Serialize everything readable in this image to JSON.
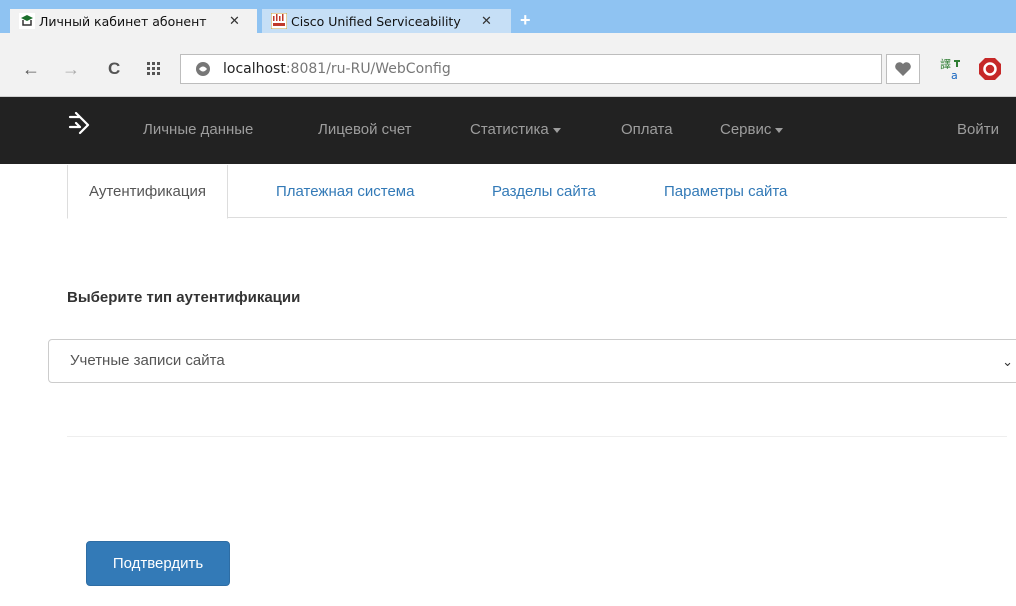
{
  "browser": {
    "tabs": [
      {
        "title": "Личный кабинет абонент",
        "close": "✕"
      },
      {
        "title": "Cisco Unified Serviceability",
        "close": "✕"
      }
    ],
    "new_tab": "+",
    "nav": {
      "back": "←",
      "forward": "→",
      "reload": "C"
    },
    "url_host": "localhost",
    "url_path": ":8081/ru-RU/WebConfig"
  },
  "navbar": {
    "items": [
      "Личные данные",
      "Лицевой счет",
      "Статистика",
      "Оплата",
      "Сервис"
    ],
    "login": "Войти"
  },
  "content_tabs": [
    "Аутентификация",
    "Платежная система",
    "Разделы сайта",
    "Параметры сайта"
  ],
  "form": {
    "label": "Выберите тип аутентификации",
    "selected": "Учетные записи сайта",
    "submit": "Подтвердить"
  },
  "colors": {
    "browser_accent": "#8fc3f2",
    "navbar_bg": "#222222",
    "link": "#337ab7",
    "primary_button": "#337ab7"
  },
  "icons": [
    "site-favicon",
    "cisco-favicon",
    "apps-grid-icon",
    "site-info-icon",
    "heart-icon",
    "translate-icon",
    "stop-icon",
    "brand-logo-icon",
    "chevron-down-icon"
  ]
}
